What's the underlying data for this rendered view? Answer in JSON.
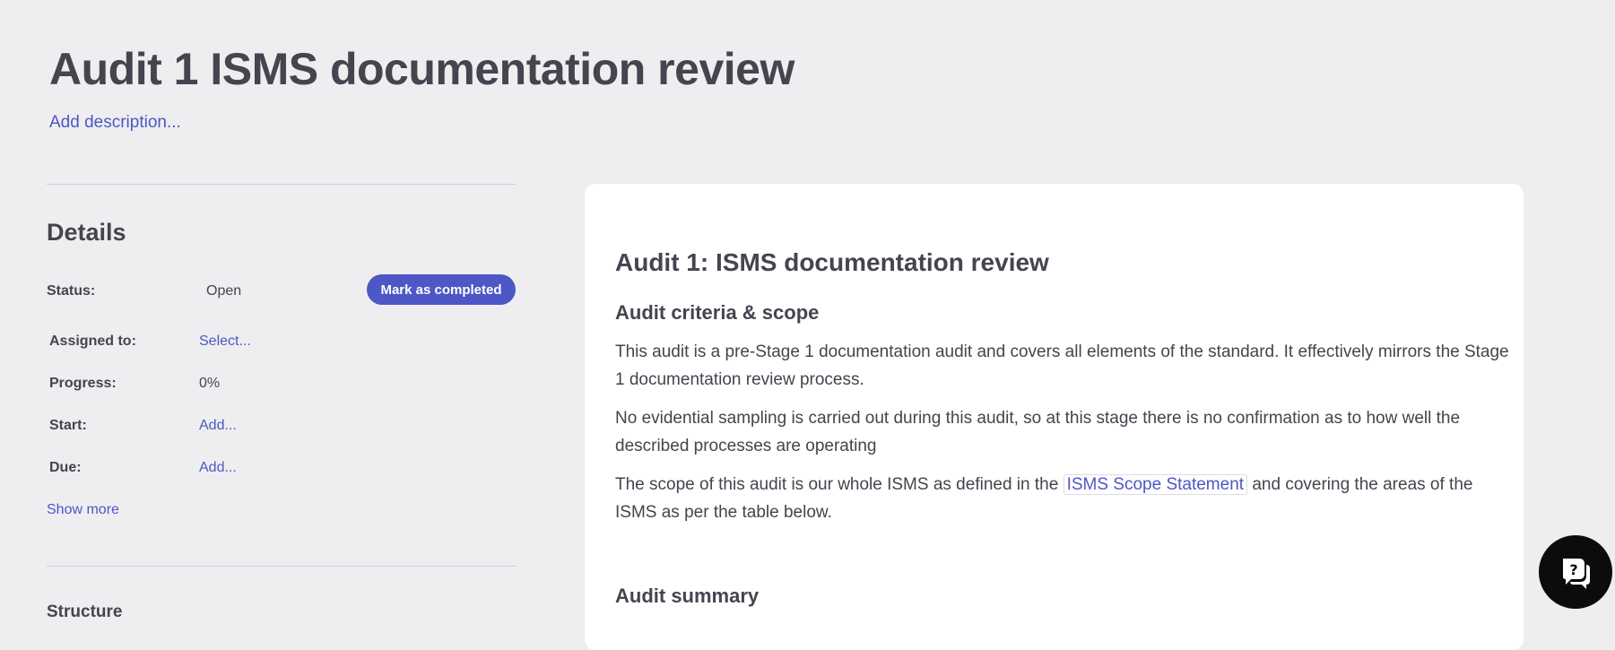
{
  "page": {
    "title": "Audit 1 ISMS documentation review",
    "add_description": "Add description..."
  },
  "details": {
    "heading": "Details",
    "status_label": "Status:",
    "status_value": "Open",
    "mark_completed": "Mark as completed",
    "assigned_label": "Assigned to:",
    "assigned_value": "Select...",
    "progress_label": "Progress:",
    "progress_value": "0%",
    "start_label": "Start:",
    "start_value": "Add...",
    "due_label": "Due:",
    "due_value": "Add...",
    "show_more": "Show more"
  },
  "structure": {
    "heading": "Structure"
  },
  "document": {
    "heading": "Audit 1: ISMS documentation review",
    "criteria_heading": "Audit criteria & scope",
    "para1": "This audit is a pre-Stage 1 documentation audit and covers all elements of the standard. It effectively mirrors the Stage 1 documentation review process.",
    "para2": "No evidential sampling is carried out during this audit, so at this stage there is no confirmation as to how well the described processes are operating",
    "para3_before": "The scope of this audit is our whole ISMS as defined in the ",
    "para3_link": "ISMS Scope Statement",
    "para3_after": " and covering the areas of the ISMS as per the table below.",
    "summary_heading": "Audit summary"
  },
  "icons": {
    "help": "help-chat-icon"
  },
  "colors": {
    "accent": "#4d57c5",
    "background": "#eeeef0",
    "text": "#45444f"
  }
}
